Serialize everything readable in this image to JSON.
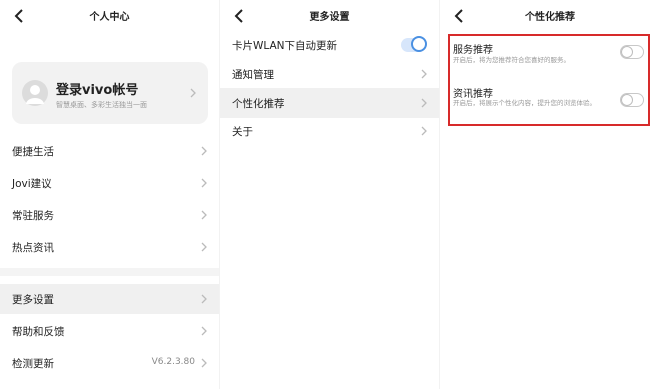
{
  "panel1": {
    "title": "个人中心",
    "profile": {
      "title": "登录vivo帐号",
      "subtitle": "智慧桌面、多彩生活独当一面"
    },
    "items": [
      {
        "label": "便捷生活"
      },
      {
        "label": "Jovi建议"
      },
      {
        "label": "常驻服务"
      },
      {
        "label": "热点资讯"
      },
      {
        "label": "更多设置"
      },
      {
        "label": "帮助和反馈"
      },
      {
        "label": "检测更新",
        "value": "V6.2.3.80"
      }
    ]
  },
  "panel2": {
    "title": "更多设置",
    "items": [
      {
        "label": "卡片WLAN下自动更新",
        "toggle": true
      },
      {
        "label": "通知管理"
      },
      {
        "label": "个性化推荐"
      },
      {
        "label": "关于"
      }
    ]
  },
  "panel3": {
    "title": "个性化推荐",
    "settings": [
      {
        "title": "服务推荐",
        "desc": "开启后，将为您推荐符合您喜好的服务。",
        "toggle": false
      },
      {
        "title": "资讯推荐",
        "desc": "开启后，将展示个性化内容，提升您的浏览体验。",
        "toggle": false
      }
    ]
  },
  "colors": {
    "accent": "#4a90e2",
    "highlight_box": "#d72a2a"
  },
  "icons": {
    "back": "chevron-left-icon",
    "next": "chevron-right-icon",
    "avatar": "user-avatar-icon"
  }
}
